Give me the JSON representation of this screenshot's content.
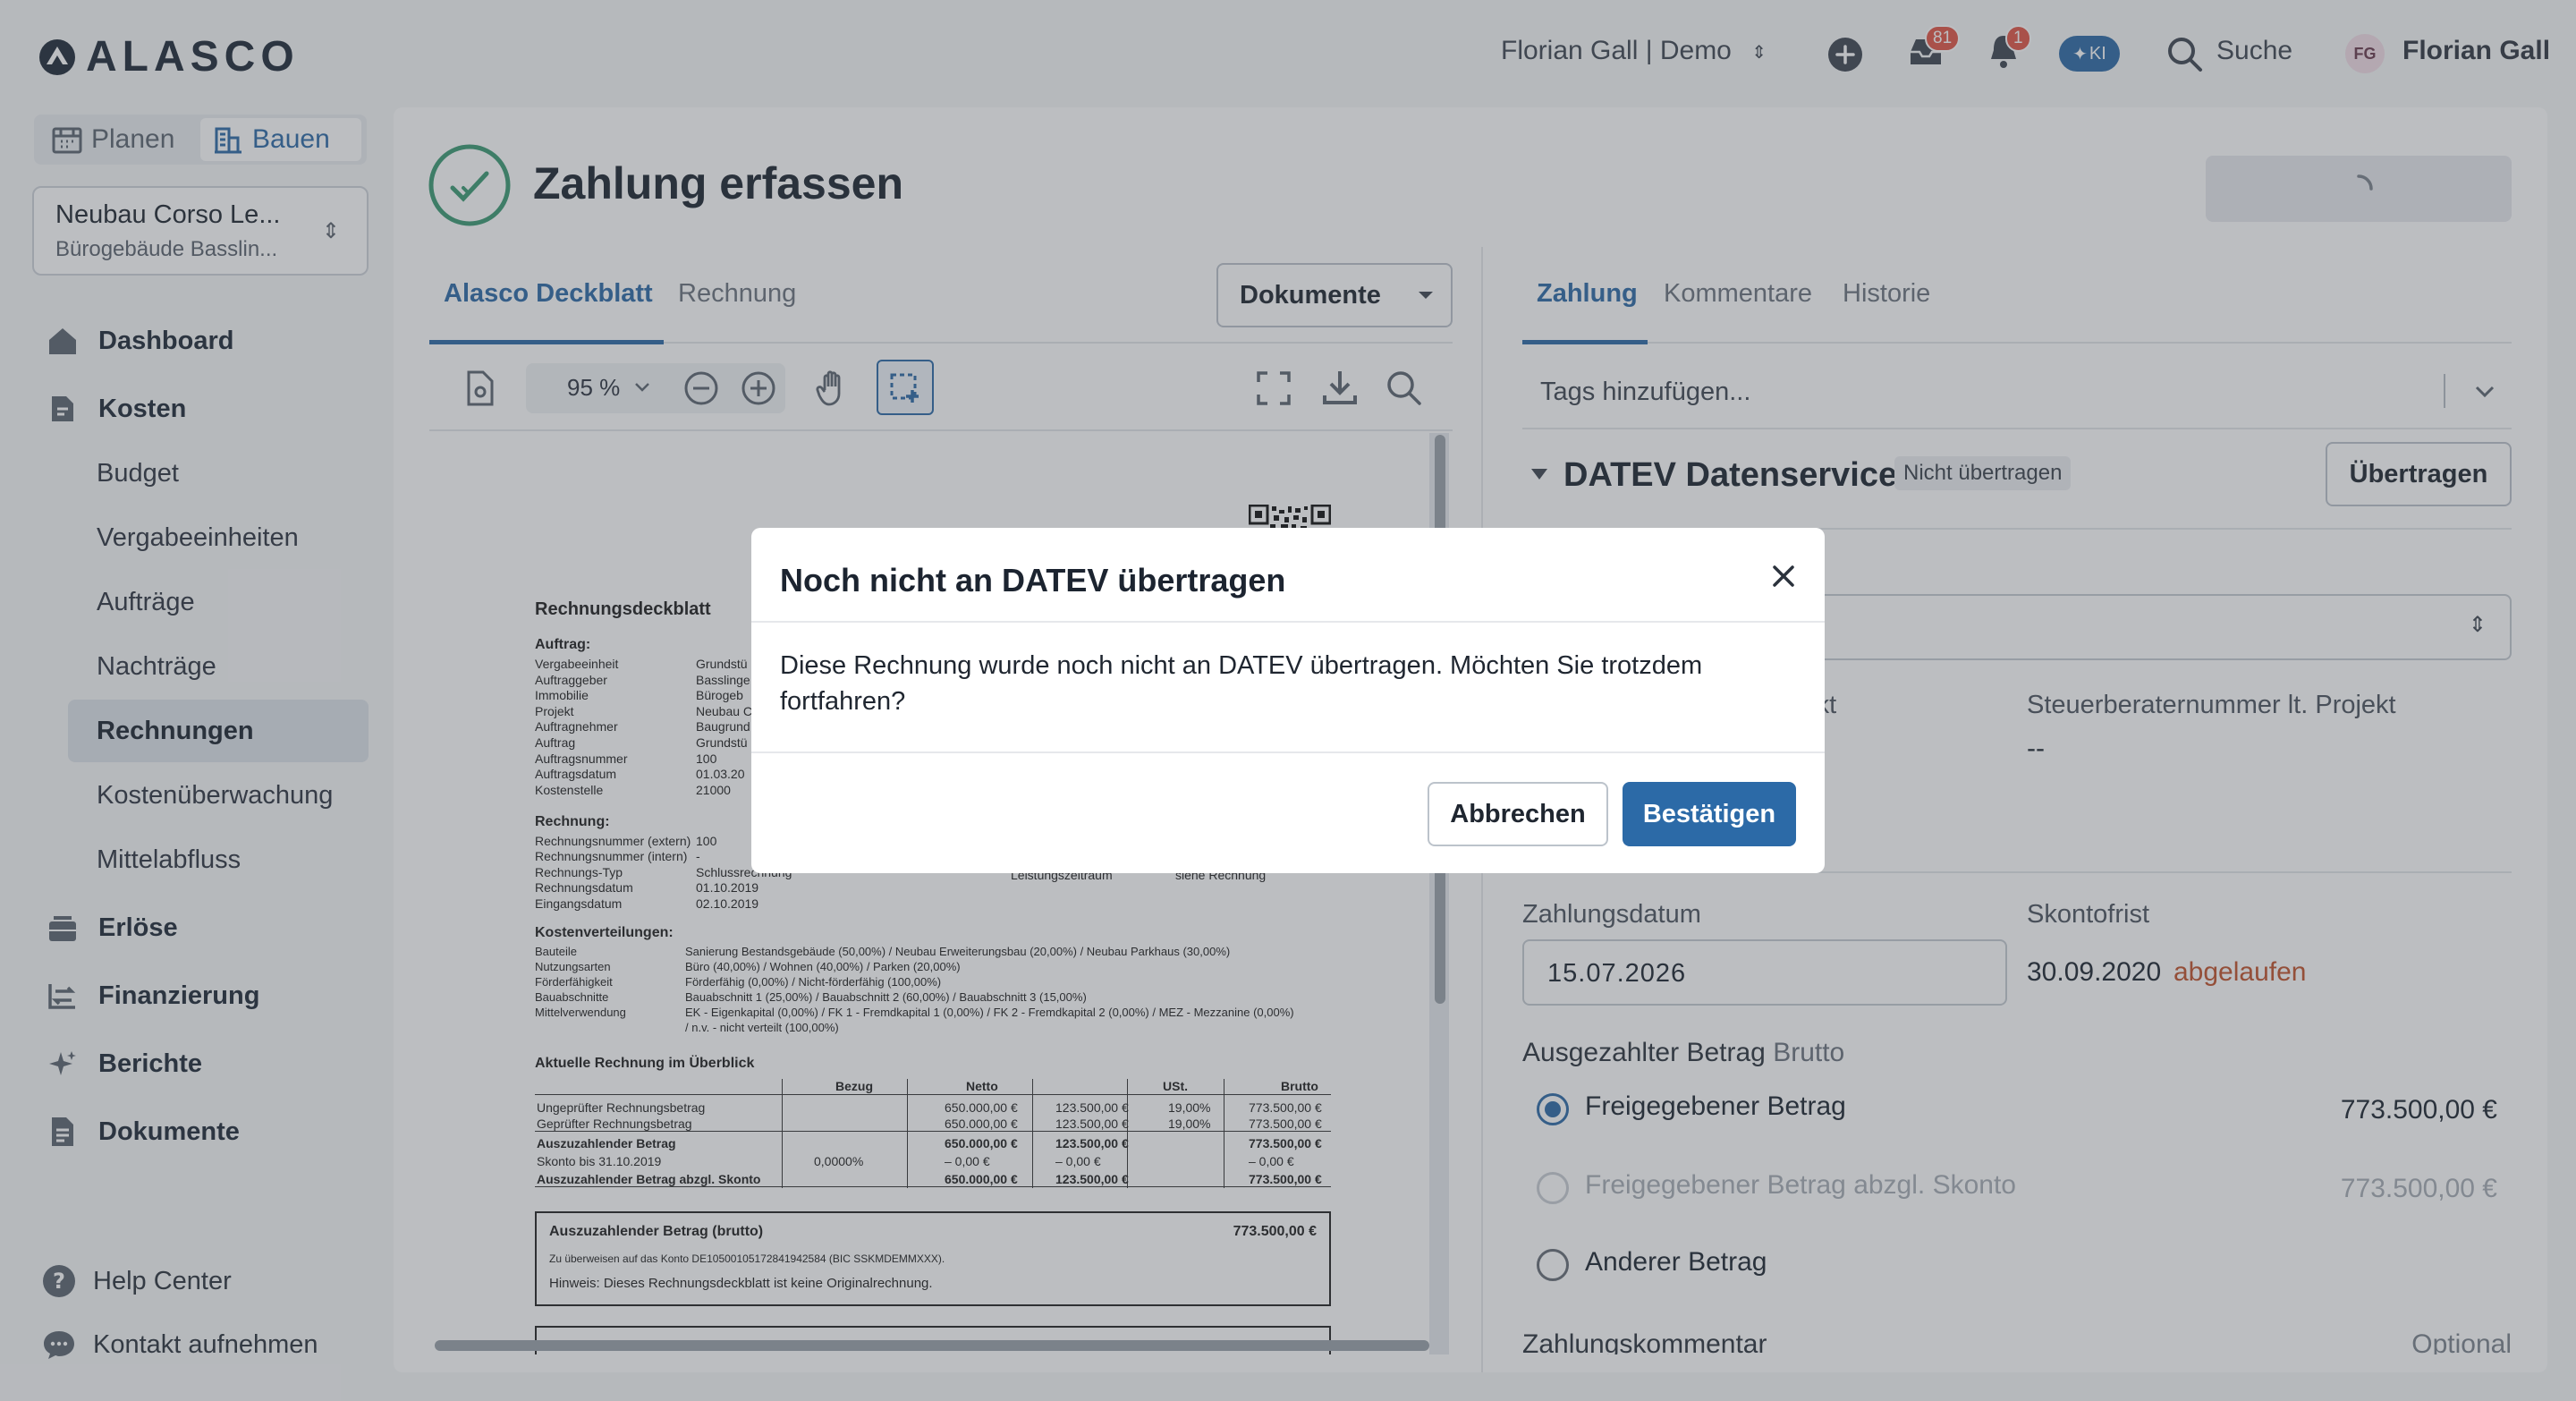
{
  "header": {
    "logo": "ALASCO",
    "user_workspace": "Florian Gall | Demo",
    "inbox_badge": "81",
    "notif_badge": "1",
    "ki_label": "KI",
    "search_label": "Suche",
    "avatar_initials": "FG",
    "user_name": "Florian Gall"
  },
  "sidebar": {
    "mode_planen": "Planen",
    "mode_bauen": "Bauen",
    "project_name": "Neubau Corso Le...",
    "project_sub": "Bürogebäude Basslin...",
    "nav": {
      "dashboard": "Dashboard",
      "kosten": "Kosten",
      "budget": "Budget",
      "vergabe": "Vergabeeinheiten",
      "auftraege": "Aufträge",
      "nachtraege": "Nachträge",
      "rechnungen": "Rechnungen",
      "kostenueberwachung": "Kostenüberwachung",
      "mittelabfluss": "Mittelabfluss",
      "erloese": "Erlöse",
      "finanzierung": "Finanzierung",
      "berichte": "Berichte",
      "dokumente": "Dokumente"
    },
    "help_center": "Help Center",
    "contact": "Kontakt aufnehmen"
  },
  "page": {
    "title": "Zahlung erfassen"
  },
  "doc_tabs": {
    "deckblatt": "Alasco Deckblatt",
    "rechnung": "Rechnung",
    "dokumente_btn": "Dokumente"
  },
  "viewer": {
    "zoom": "95 %"
  },
  "document": {
    "heading": "Rechnungsdeckblatt",
    "auftrag_title": "Auftrag:",
    "auftrag_rows": [
      {
        "k": "Vergabeeinheit",
        "v": "Grundstü"
      },
      {
        "k": "Auftraggeber",
        "v": "Basslinge"
      },
      {
        "k": "Immobilie",
        "v": "Bürogeb"
      },
      {
        "k": "Projekt",
        "v": "Neubau C"
      },
      {
        "k": "Auftragnehmer",
        "v": "Baugrund"
      },
      {
        "k": "Auftrag",
        "v": "Grundstü"
      },
      {
        "k": "Auftragsnummer",
        "v": "100"
      },
      {
        "k": "Auftragsdatum",
        "v": "01.03.20"
      },
      {
        "k": "Kostenstelle",
        "v": "21000"
      }
    ],
    "rechnung_title": "Rechnung:",
    "rechnung_rows": [
      {
        "k": "Rechnungsnummer (extern)",
        "v": "100"
      },
      {
        "k": "Rechnungsnummer (intern)",
        "v": "-"
      },
      {
        "k": "Rechnungs-Typ",
        "v": "Schlussrechnung"
      },
      {
        "k": "Rechnungsdatum",
        "v": "01.10.2019"
      },
      {
        "k": "Eingangsdatum",
        "v": "02.10.2019"
      }
    ],
    "leistungszeitraum_label": "Leistungszeitraum",
    "leistungszeitraum_value": "siehe Rechnung",
    "kv_title": "Kostenverteilungen:",
    "kv_rows": [
      {
        "k": "Bauteile",
        "v": "Sanierung Bestandsgebäude (50,00%) / Neubau Erweiterungsbau (20,00%) / Neubau Parkhaus (30,00%)"
      },
      {
        "k": "Nutzungsarten",
        "v": "Büro (40,00%) / Wohnen (40,00%) / Parken (20,00%)"
      },
      {
        "k": "Förderfähigkeit",
        "v": "Förderfähig (0,00%) / Nicht-förderfähig (100,00%)"
      },
      {
        "k": "Bauabschnitte",
        "v": "Bauabschnitt 1 (25,00%) / Bauabschnitt 2 (60,00%) / Bauabschnitt 3 (15,00%)"
      },
      {
        "k": "Mittelverwendung",
        "v": "EK - Eigenkapital (0,00%) / FK 1 - Fremdkapital 1 (0,00%) / FK 2 - Fremdkapital 2 (0,00%) / MEZ - Mezzanine (0,00%)"
      },
      {
        "k": "",
        "v": "/ n.v. - nicht verteilt (100,00%)"
      }
    ],
    "overview_title": "Aktuelle Rechnung im Überblick",
    "table_headers": [
      "Bezug",
      "Netto",
      "USt.",
      "Brutto"
    ],
    "table_rows": [
      {
        "label": "Ungeprüfter Rechnungsbetrag",
        "bezug": "",
        "netto": "650.000,00 €",
        "ust": "123.500,00 €",
        "pct": "19,00%",
        "brutto": "773.500,00 €",
        "bold": false
      },
      {
        "label": "Geprüfter Rechnungsbetrag",
        "bezug": "",
        "netto": "650.000,00 €",
        "ust": "123.500,00 €",
        "pct": "19,00%",
        "brutto": "773.500,00 €",
        "bold": false
      },
      {
        "label": "Auszuzahlender Betrag",
        "bezug": "",
        "netto": "650.000,00 €",
        "ust": "123.500,00 €",
        "pct": "",
        "brutto": "773.500,00 €",
        "bold": true
      },
      {
        "label": "Skonto bis 31.10.2019",
        "bezug": "0,0000%",
        "netto": "– 0,00 €",
        "ust": "– 0,00 €",
        "pct": "",
        "brutto": "– 0,00 €",
        "bold": false
      },
      {
        "label": "Auszuzahlender Betrag abzgl. Skonto",
        "bezug": "",
        "netto": "650.000,00 €",
        "ust": "123.500,00 €",
        "pct": "",
        "brutto": "773.500,00 €",
        "bold": true
      }
    ],
    "box_label": "Auszuzahlender Betrag (brutto)",
    "box_amount": "773.500,00 €",
    "box_account": "Zu überweisen auf das Konto DE10500105172841942584 (BIC SSKMDEMMXXX).",
    "box_note": "Hinweis: Dieses Rechnungsdeckblatt ist keine Originalrechnung."
  },
  "right_tabs": {
    "zahlung": "Zahlung",
    "kommentare": "Kommentare",
    "historie": "Historie"
  },
  "right": {
    "tags_placeholder": "Tags hinzufügen...",
    "datev_title": "DATEV Datenservice",
    "datev_status": "Nicht übertragen",
    "uebertragen_btn": "Übertragen",
    "projekt_label_partial": "jekt",
    "steuerberater_label": "Steuerberaternummer lt. Projekt",
    "steuerberater_value": "--",
    "zahlungsdatum_label": "Zahlungsdatum",
    "zahlungsdatum_value": "15.07.2026",
    "skontofrist_label": "Skontofrist",
    "skontofrist_value": "30.09.2020",
    "skontofrist_status": "abgelaufen",
    "betrag_label": "Ausgezahlter Betrag",
    "betrag_suffix": "Brutto",
    "opt1_label": "Freigegebener Betrag",
    "opt1_amount": "773.500,00 €",
    "opt2_label": "Freigegebener Betrag abzgl. Skonto",
    "opt2_amount": "773.500,00 €",
    "opt3_label": "Anderer Betrag",
    "kommentar_label": "Zahlungskommentar",
    "kommentar_optional": "Optional"
  },
  "modal": {
    "title": "Noch nicht an DATEV übertragen",
    "body": "Diese Rechnung wurde noch nicht an DATEV übertragen. Möchten Sie trotzdem fortfahren?",
    "cancel": "Abbrechen",
    "confirm": "Bestätigen"
  },
  "colors": {
    "accent": "#2c6aa7",
    "success": "#3a9a73",
    "warning_text": "#c0522b",
    "badge": "#e25545"
  }
}
